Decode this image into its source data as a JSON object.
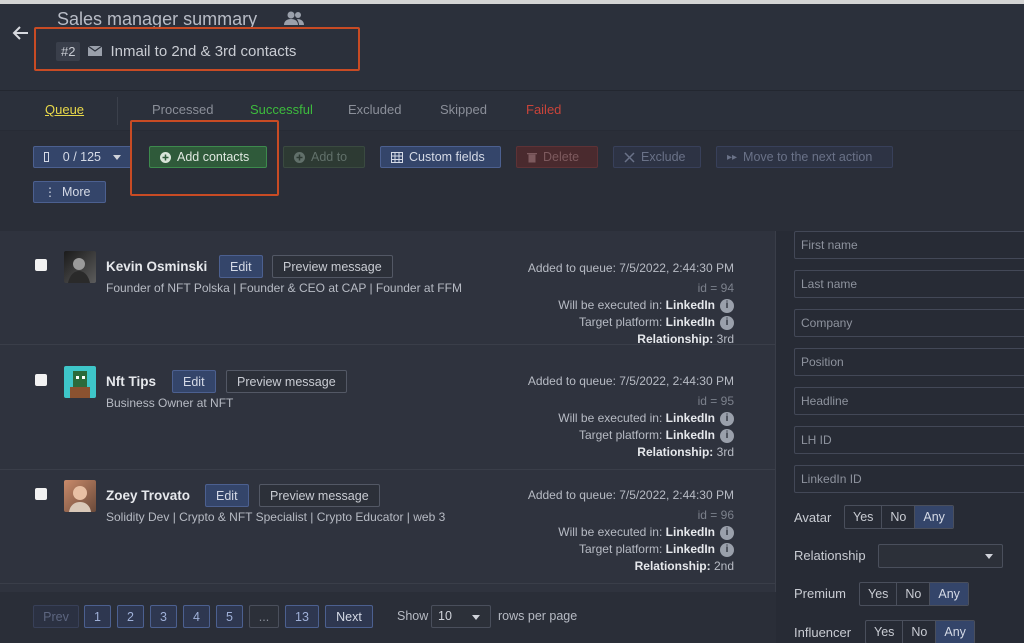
{
  "header": {
    "title": "Sales manager summary",
    "step_number": "#2",
    "step_label": "Inmail to 2nd & 3rd contacts"
  },
  "tabs": [
    {
      "label": "Queue",
      "color": "#e8d84a"
    },
    {
      "label": "Processed",
      "color": "#8b8f99"
    },
    {
      "label": "Successful",
      "color": "#3dbb3d"
    },
    {
      "label": "Excluded",
      "color": "#8b8f99"
    },
    {
      "label": "Skipped",
      "color": "#8b8f99"
    },
    {
      "label": "Failed",
      "color": "#c8443a"
    }
  ],
  "toolbar": {
    "select_count": "0 / 125",
    "add_contacts": "Add contacts",
    "add_to": "Add to",
    "custom_fields": "Custom fields",
    "delete": "Delete",
    "exclude": "Exclude",
    "move_next": "Move to the next action",
    "more": "More"
  },
  "contacts": [
    {
      "name": "Kevin Osminski",
      "description": "Founder of NFT Polska | Founder & CEO at CAP | Founder at FFM",
      "added": "Added to queue: 7/5/2022, 2:44:30 PM",
      "id": "id = 94",
      "executed_label": "Will be executed in:",
      "executed_value": "LinkedIn",
      "target_label": "Target platform:",
      "target_value": "LinkedIn",
      "relationship_label": "Relationship:",
      "relationship_value": "3rd",
      "edit": "Edit",
      "preview": "Preview message"
    },
    {
      "name": "Nft Tips",
      "description": "Business Owner at NFT",
      "added": "Added to queue: 7/5/2022, 2:44:30 PM",
      "id": "id = 95",
      "executed_label": "Will be executed in:",
      "executed_value": "LinkedIn",
      "target_label": "Target platform:",
      "target_value": "LinkedIn",
      "relationship_label": "Relationship:",
      "relationship_value": "3rd",
      "edit": "Edit",
      "preview": "Preview message"
    },
    {
      "name": "Zoey Trovato",
      "description": "Solidity Dev | Crypto & NFT Specialist | Crypto Educator | web 3",
      "added": "Added to queue: 7/5/2022, 2:44:30 PM",
      "id": "id = 96",
      "executed_label": "Will be executed in:",
      "executed_value": "LinkedIn",
      "target_label": "Target platform:",
      "target_value": "LinkedIn",
      "relationship_label": "Relationship:",
      "relationship_value": "2nd",
      "edit": "Edit",
      "preview": "Preview message"
    }
  ],
  "pagination": {
    "prev": "Prev",
    "pages": [
      "1",
      "2",
      "3",
      "4",
      "5",
      "...",
      "13"
    ],
    "next": "Next",
    "show_label": "Show",
    "per_page": "10",
    "rows_label": "rows per page"
  },
  "filters": {
    "placeholders": [
      "First name",
      "Last name",
      "Company",
      "Position",
      "Headline",
      "LH ID",
      "LinkedIn ID"
    ],
    "avatar_label": "Avatar",
    "relationship_label": "Relationship",
    "premium_label": "Premium",
    "influencer_label": "Influencer",
    "yes": "Yes",
    "no": "No",
    "any": "Any"
  }
}
